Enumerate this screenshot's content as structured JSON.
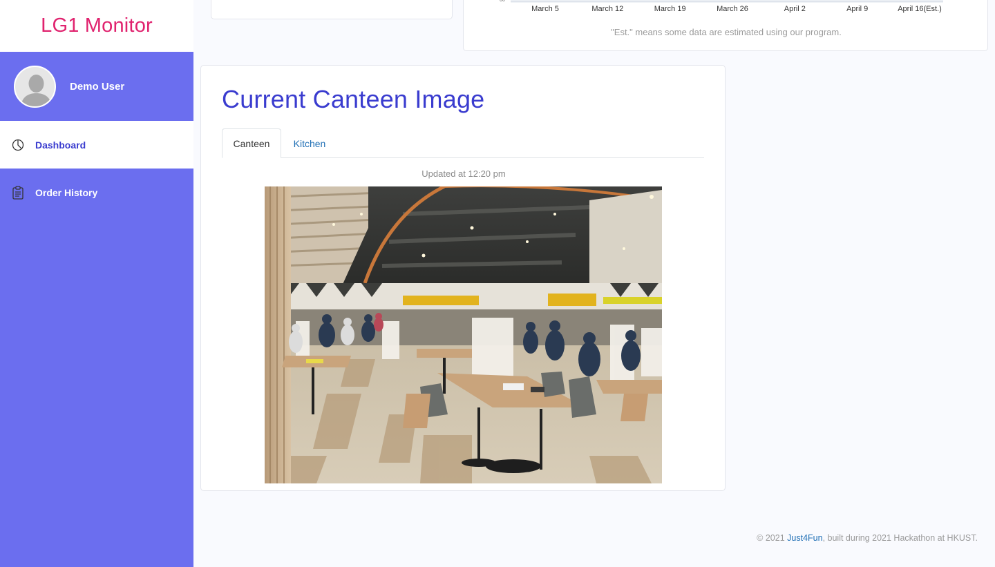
{
  "brand": {
    "title": "LG1 Monitor"
  },
  "user": {
    "name": "Demo User"
  },
  "nav": {
    "dashboard": "Dashboard",
    "order_history": "Order History"
  },
  "chart_partial": {
    "x_ticks": [
      "March 5",
      "March 12",
      "March 19",
      "March 26",
      "April 2",
      "April 9",
      "April 16(Est.)"
    ],
    "note": "\"Est.\" means some data are estimated using our program."
  },
  "main": {
    "title": "Current Canteen Image",
    "tabs": {
      "canteen": "Canteen",
      "kitchen": "Kitchen"
    },
    "updated": "Updated at 12:20 pm"
  },
  "footer": {
    "prefix": "© 2021 ",
    "link": "Just4Fun",
    "suffix": ", built during 2021 Hackathon at HKUST."
  },
  "colors": {
    "brand": "#e0226e",
    "sidebar": "#6b6eef",
    "accent": "#3a3ccf",
    "link": "#1f6fb5"
  },
  "icons": {
    "dashboard": "pie-chart-icon",
    "order_history": "clipboard-icon"
  }
}
